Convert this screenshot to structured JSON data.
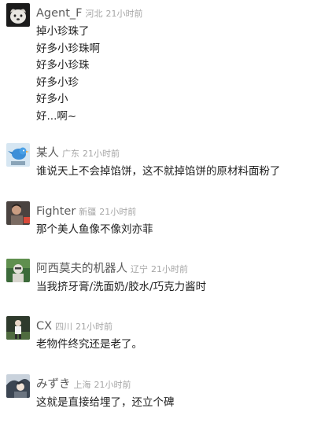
{
  "comments": [
    {
      "name": "Agent_F",
      "location": "河北",
      "time": "21小时前",
      "lines": [
        "掉小珍珠了",
        "好多小珍珠啊",
        "好多小珍珠",
        "好多小珍",
        "好多小",
        "好...啊~"
      ]
    },
    {
      "name": "某人",
      "location": "广东",
      "time": "21小时前",
      "lines": [
        "谁说天上不会掉馅饼，这不就掉馅饼的原材料面粉了"
      ]
    },
    {
      "name": "Fighter",
      "location": "新疆",
      "time": "21小时前",
      "lines": [
        "那个美人鱼像不像刘亦菲"
      ]
    },
    {
      "name": "阿西莫夫的机器人",
      "location": "辽宁",
      "time": "21小时前",
      "lines": [
        "当我挤牙膏/洗面奶/胶水/巧克力酱时"
      ]
    },
    {
      "name": "CX",
      "location": "四川",
      "time": "21小时前",
      "lines": [
        "老物件终究还是老了。"
      ]
    },
    {
      "name": "みずき",
      "location": "上海",
      "time": "21小时前",
      "lines": [
        "这就是直接给埋了，还立个碑"
      ]
    }
  ]
}
